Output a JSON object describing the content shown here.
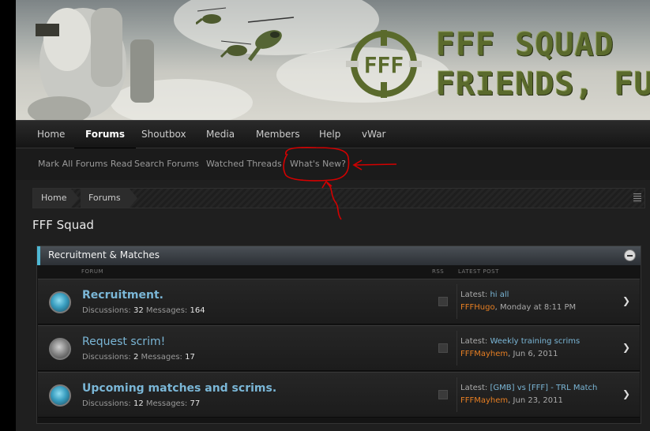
{
  "header": {
    "logo_mark": "FFF",
    "logo_line1": "FFF SQUAD",
    "logo_line2": "FRIENDS, FUN"
  },
  "nav": {
    "items": [
      "Home",
      "Forums",
      "Shoutbox",
      "Media",
      "Members",
      "Help",
      "vWar"
    ],
    "active": "Forums"
  },
  "subnav": {
    "items": [
      "Mark All Forums Read",
      "Search Forums",
      "Watched Threads",
      "What's New?"
    ]
  },
  "breadcrumb": [
    "Home",
    "Forums"
  ],
  "page_title": "FFF Squad",
  "category": {
    "title": "Recruitment & Matches",
    "col_forum": "FORUM",
    "col_rss": "RSS",
    "col_latest": "LATEST POST"
  },
  "forums": [
    {
      "name": "Recruitment.",
      "discussions_label": "Discussions:",
      "discussions": "32",
      "messages_label": "Messages:",
      "messages": "164",
      "latest_label": "Latest:",
      "latest_thread": "hi all",
      "latest_user": "FFFHugo",
      "latest_time": ", Monday at 8:11 PM",
      "status": "new"
    },
    {
      "name": "Request scrim!",
      "discussions_label": "Discussions:",
      "discussions": "2",
      "messages_label": "Messages:",
      "messages": "17",
      "latest_label": "Latest:",
      "latest_thread": "Weekly training scrims",
      "latest_user": "FFFMayhem",
      "latest_time": ", Jun 6, 2011",
      "status": "read"
    },
    {
      "name": "Upcoming matches and scrims.",
      "discussions_label": "Discussions:",
      "discussions": "12",
      "messages_label": "Messages:",
      "messages": "77",
      "latest_label": "Latest:",
      "latest_thread": "[GMB] vs [FFF] - TRL Match",
      "latest_user": "FFFMayhem",
      "latest_time": ", Jun 23, 2011",
      "status": "new"
    }
  ],
  "colors": {
    "accent_blue": "#4fb8d4",
    "link": "#7ab6d6",
    "username": "#e67e22",
    "annotation_red": "#d40000"
  }
}
